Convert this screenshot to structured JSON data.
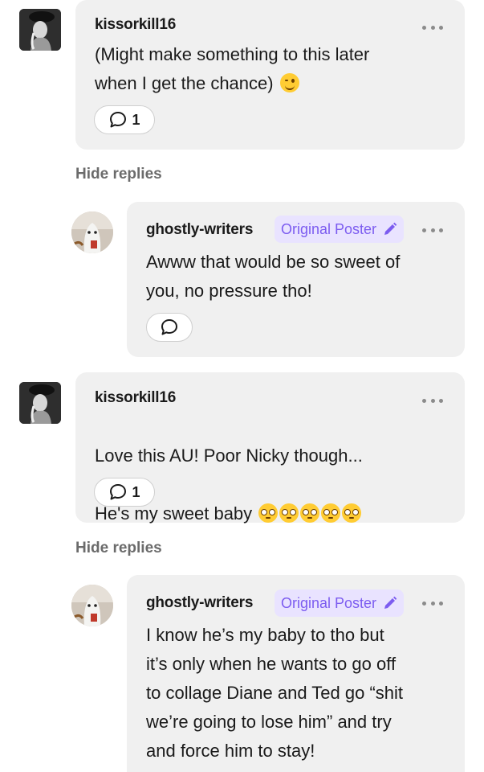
{
  "comments": [
    {
      "username": "kissorkill16",
      "text": "(Might make something to this later\nwhen I get the chance)",
      "reply_count": "1"
    },
    {
      "username": "kissorkill16",
      "text_line1": "Love this AU! Poor Nicky though...",
      "text_line2": "He's my sweet baby",
      "reply_count": "1"
    }
  ],
  "replies": [
    {
      "username": "ghostly-writers",
      "badge": "Original Poster",
      "text": "Awww that would be so sweet of\nyou, no pressure tho!"
    },
    {
      "username": "ghostly-writers",
      "badge": "Original Poster",
      "text": "I know he’s my baby to tho but\nit’s only when he wants to go off\nto collage Diane and Ted go “shit\nwe’re going to lose him” and try\nand force him to stay!"
    }
  ],
  "hide_replies_label": "Hide replies",
  "colors": {
    "badge_bg": "#e9e3ff",
    "badge_text": "#7c5cf0",
    "bubble_bg": "#f0f0f0"
  },
  "icons": [
    "comment-bubble-icon",
    "pencil-icon",
    "more-options-icon"
  ]
}
